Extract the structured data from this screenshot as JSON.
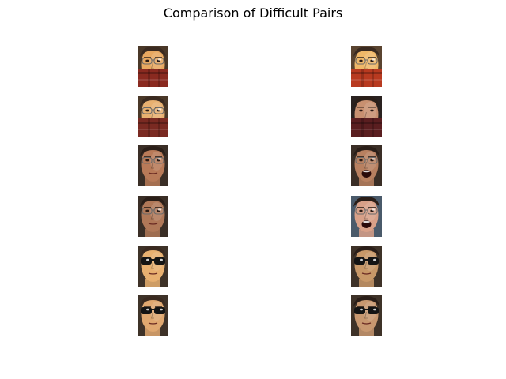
{
  "figure": {
    "title": "Comparison of Difficult Pairs"
  },
  "pairs": [
    {
      "left": {
        "style": "muffler",
        "skin": "#e8a860",
        "hair": "#3a2a20",
        "bg": "#4a3828",
        "cover": "#8a2a20",
        "mouth": "covered",
        "eyewear": "clear-glasses"
      },
      "right": {
        "style": "muffler",
        "skin": "#f0b868",
        "hair": "#3a2a20",
        "bg": "#5a4430",
        "cover": "#b83a20",
        "mouth": "covered",
        "eyewear": "clear-glasses"
      }
    },
    {
      "left": {
        "style": "muffler",
        "skin": "#e8b070",
        "hair": "#3a2a20",
        "bg": "#4a3828",
        "cover": "#7a2a22",
        "mouth": "covered",
        "eyewear": "clear-glasses"
      },
      "right": {
        "style": "muffler",
        "skin": "#c89070",
        "hair": "#2a1e18",
        "bg": "#2a2220",
        "cover": "#5a1e20",
        "mouth": "covered",
        "eyewear": "none"
      }
    },
    {
      "left": {
        "style": "plain",
        "skin": "#b87a58",
        "hair": "#2a1e18",
        "bg": "#3a2e26",
        "cover": "",
        "mouth": "neutral",
        "eyewear": "clear-glasses"
      },
      "right": {
        "style": "plain",
        "skin": "#b88060",
        "hair": "#2a1e18",
        "bg": "#3a2e26",
        "cover": "",
        "mouth": "open",
        "eyewear": "clear-glasses"
      }
    },
    {
      "left": {
        "style": "plain",
        "skin": "#b07858",
        "hair": "#2a1e18",
        "bg": "#3a2e26",
        "cover": "",
        "mouth": "neutral",
        "eyewear": "clear-glasses"
      },
      "right": {
        "style": "plain",
        "skin": "#d8a088",
        "hair": "#2a1e18",
        "bg": "#4a5a6a",
        "cover": "",
        "mouth": "open",
        "eyewear": "clear-glasses"
      }
    },
    {
      "left": {
        "style": "plain",
        "skin": "#e8b070",
        "hair": "#3a2a20",
        "bg": "#3e3228",
        "cover": "",
        "mouth": "neutral",
        "eyewear": "sunglasses"
      },
      "right": {
        "style": "plain",
        "skin": "#c89868",
        "hair": "#2a1e18",
        "bg": "#3e3228",
        "cover": "",
        "mouth": "neutral",
        "eyewear": "sunglasses"
      }
    },
    {
      "left": {
        "style": "plain",
        "skin": "#e0a870",
        "hair": "#3a2a20",
        "bg": "#3e3228",
        "cover": "",
        "mouth": "neutral",
        "eyewear": "sunglasses"
      },
      "right": {
        "style": "plain",
        "skin": "#c89870",
        "hair": "#2a1e18",
        "bg": "#3e3228",
        "cover": "",
        "mouth": "neutral",
        "eyewear": "sunglasses"
      }
    }
  ]
}
